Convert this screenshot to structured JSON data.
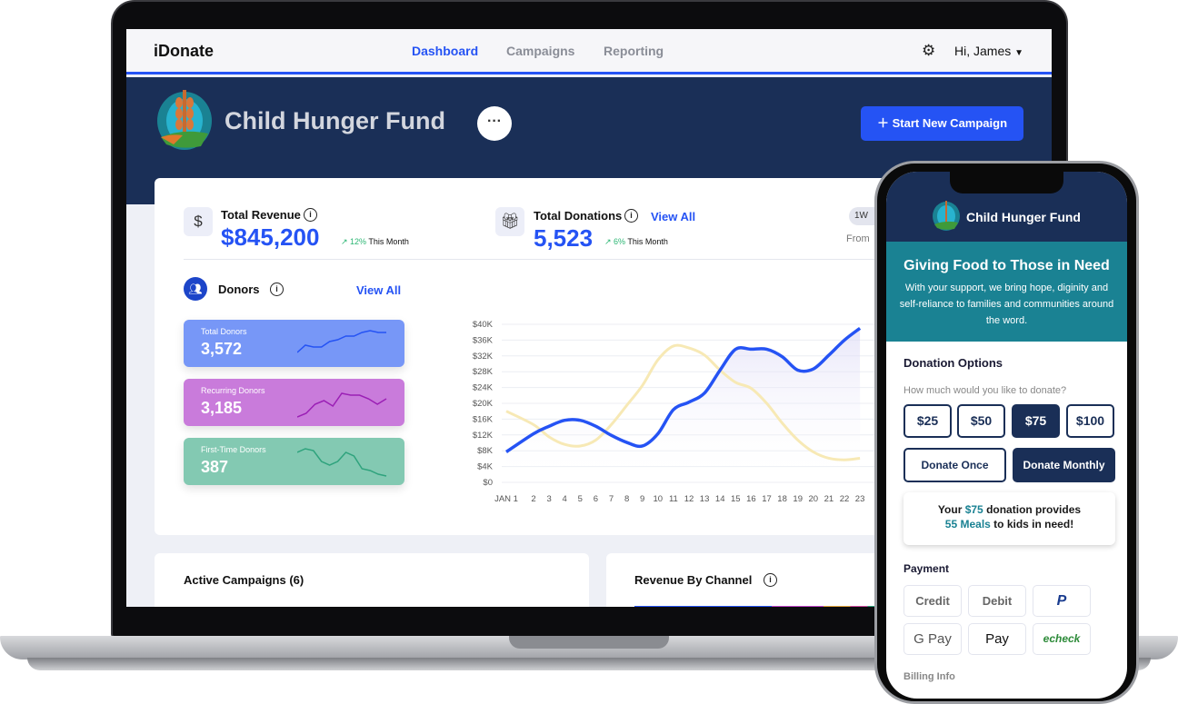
{
  "dashboard": {
    "brand": "iDonate",
    "nav": [
      "Dashboard",
      "Campaigns",
      "Reporting"
    ],
    "active_nav": "Dashboard",
    "user_greeting": "Hi, James",
    "org_name": "Child Hunger Fund",
    "more_label": "···",
    "start_campaign_label": "Start New Campaign",
    "total_revenue": {
      "label": "Total Revenue",
      "value": "$845,200",
      "delta": "12%",
      "period": "This Month"
    },
    "total_donations": {
      "label": "Total Donations",
      "value": "5,523",
      "delta": "6%",
      "period": "This Month",
      "link": "View All"
    },
    "range_button": "1W",
    "from_label": "From",
    "donors": {
      "label": "Donors",
      "link": "View All",
      "cards": [
        {
          "label": "Total Donors",
          "value": "3,572",
          "color": "#7797f7",
          "line": "#2553f4"
        },
        {
          "label": "Recurring Donors",
          "value": "3,185",
          "color": "#c97bdb",
          "line": "#9b1fb5"
        },
        {
          "label": "First-Time Donors",
          "value": "387",
          "color": "#83c9b2",
          "line": "#2fa37d"
        }
      ]
    },
    "active_campaigns_label": "Active Campaigns (6)",
    "revenue_by_channel_label": "Revenue By Channel"
  },
  "chart_data": {
    "type": "line",
    "y_ticks": [
      "$40K",
      "$36K",
      "$32K",
      "$28K",
      "$24K",
      "$20K",
      "$16K",
      "$12K",
      "$8K",
      "$4K",
      "$0"
    ],
    "ylim": [
      0,
      40000
    ],
    "x_ticks": [
      "JAN 1",
      "2",
      "3",
      "4",
      "5",
      "6",
      "7",
      "8",
      "9",
      "10",
      "11",
      "12",
      "13",
      "14",
      "15",
      "16",
      "17",
      "18",
      "19",
      "20",
      "21",
      "22",
      "23"
    ],
    "grid": true,
    "series": [
      {
        "color": "#2553f4",
        "values": [
          7700,
          12300,
          14200,
          15700,
          15700,
          14200,
          11900,
          10100,
          9200,
          12300,
          18400,
          20300,
          22600,
          28400,
          33700,
          33700,
          33700,
          31800,
          28400,
          28700,
          32200,
          36000,
          39000
        ]
      },
      {
        "color": "#f7e9b5",
        "values": [
          18000,
          14600,
          11500,
          9600,
          9200,
          10700,
          14600,
          19500,
          24500,
          31000,
          34500,
          34000,
          32200,
          28400,
          25300,
          23800,
          20000,
          15000,
          10700,
          7700,
          6100,
          5700,
          6100
        ]
      }
    ]
  },
  "phone": {
    "org_name": "Child Hunger Fund",
    "headline": "Giving Food to Those in Need",
    "description": "With your support, we bring hope, diginity and self-reliance to families and communities around the word.",
    "options_title": "Donation Options",
    "question": "How much would you like to donate?",
    "amounts": [
      "$25",
      "$50",
      "$75",
      "$100"
    ],
    "selected_amount": "$75",
    "frequency": [
      "Donate Once",
      "Donate Monthly"
    ],
    "selected_frequency": "Donate Monthly",
    "impact": {
      "pre": "Your ",
      "amount": "$75",
      "mid": " donation provides",
      "meals": "55 Meals",
      "post": " to kids in need!"
    },
    "payment_title": "Payment",
    "payment_methods": [
      "Credit",
      "Debit",
      "PayPal",
      "G Pay",
      "Pay",
      "echeck"
    ],
    "billing_label": "Billing Info"
  }
}
